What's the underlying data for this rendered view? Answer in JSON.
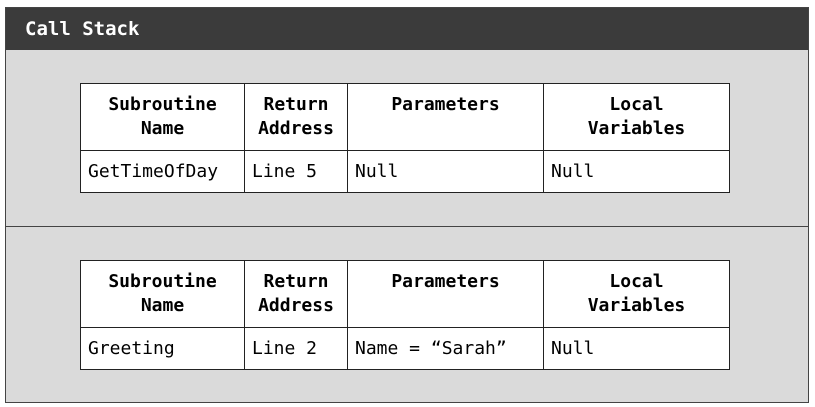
{
  "panel": {
    "title": "Call Stack"
  },
  "columns": {
    "subroutine_line1": "Subroutine",
    "subroutine_line2": "Name",
    "return_line1": "Return",
    "return_line2": "Address",
    "parameters": "Parameters",
    "local_line1": "Local",
    "local_line2": "Variables"
  },
  "frames": [
    {
      "name": "GetTimeOfDay",
      "return_address": "Line 5",
      "parameters": "Null",
      "local_variables": "Null"
    },
    {
      "name": "Greeting",
      "return_address": "Line 2",
      "parameters": "Name = “Sarah”",
      "local_variables": "Null"
    }
  ]
}
